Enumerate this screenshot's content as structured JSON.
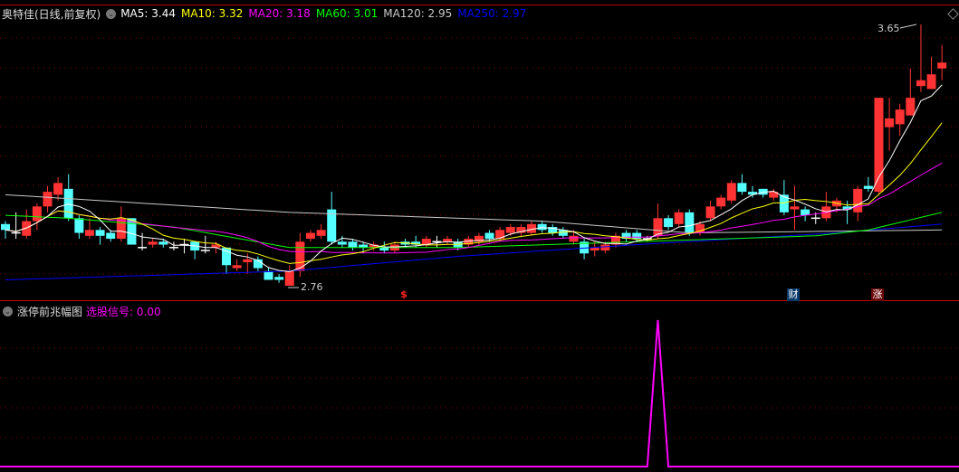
{
  "header": {
    "stock_name": "奥特佳(日线,前复权)",
    "ma_labels": [
      {
        "text": "MA5: 3.44",
        "color": "#ffffff"
      },
      {
        "text": "MA10: 3.32",
        "color": "#ffff00"
      },
      {
        "text": "MA20: 3.18",
        "color": "#ff00ff"
      },
      {
        "text": "MA60: 3.01",
        "color": "#00ff00"
      },
      {
        "text": "MA120: 2.95",
        "color": "#c8c8c8"
      },
      {
        "text": "MA250: 2.97",
        "color": "#0000ff"
      }
    ]
  },
  "indicator": {
    "name": "涨停前兆幅图",
    "signal_label": "选股信号: 0.00",
    "signal_color": "#ff00ff"
  },
  "annotations": {
    "high_label": "3.65",
    "low_label": "2.76",
    "marker_dollar": "$",
    "marker_cai": "财",
    "marker_zhang": "涨"
  },
  "colors": {
    "up": "#ff3333",
    "down": "#55ffff",
    "doji": "#ffffff",
    "grid": "#880000",
    "separator": "#cc0000"
  },
  "chart_data": {
    "type": "candlestick",
    "ylim": [
      2.76,
      3.65
    ],
    "candles": [
      [
        2.97,
        2.95,
        2.98,
        2.92
      ],
      [
        2.94,
        2.94,
        3.01,
        2.92
      ],
      [
        2.93,
        2.98,
        3.02,
        2.92
      ],
      [
        2.98,
        3.03,
        3.04,
        2.95
      ],
      [
        3.03,
        3.08,
        3.1,
        3.01
      ],
      [
        3.07,
        3.11,
        3.13,
        3.05
      ],
      [
        3.09,
        2.99,
        3.14,
        2.98
      ],
      [
        2.99,
        2.94,
        3.0,
        2.92
      ],
      [
        2.93,
        2.95,
        2.99,
        2.92
      ],
      [
        2.95,
        2.93,
        2.96,
        2.9
      ],
      [
        2.94,
        2.92,
        2.95,
        2.91
      ],
      [
        2.92,
        2.99,
        3.03,
        2.91
      ],
      [
        2.99,
        2.9,
        2.99,
        2.9
      ],
      [
        2.89,
        2.89,
        2.94,
        2.88
      ],
      [
        2.9,
        2.91,
        2.92,
        2.89
      ],
      [
        2.91,
        2.9,
        2.92,
        2.89
      ],
      [
        2.89,
        2.89,
        2.91,
        2.88
      ],
      [
        2.9,
        2.9,
        2.92,
        2.87
      ],
      [
        2.91,
        2.88,
        2.91,
        2.85
      ],
      [
        2.88,
        2.88,
        2.93,
        2.87
      ],
      [
        2.89,
        2.9,
        2.91,
        2.87
      ],
      [
        2.89,
        2.83,
        2.89,
        2.8
      ],
      [
        2.82,
        2.83,
        2.85,
        2.81
      ],
      [
        2.84,
        2.85,
        2.87,
        2.8
      ],
      [
        2.85,
        2.82,
        2.86,
        2.81
      ],
      [
        2.81,
        2.78,
        2.82,
        2.78
      ],
      [
        2.79,
        2.78,
        2.8,
        2.77
      ],
      [
        2.76,
        2.81,
        2.83,
        2.76
      ],
      [
        2.81,
        2.91,
        2.94,
        2.79
      ],
      [
        2.92,
        2.94,
        2.95,
        2.91
      ],
      [
        2.93,
        2.95,
        2.97,
        2.92
      ],
      [
        3.02,
        2.91,
        3.08,
        2.9
      ],
      [
        2.91,
        2.9,
        2.93,
        2.89
      ],
      [
        2.91,
        2.89,
        2.92,
        2.88
      ],
      [
        2.9,
        2.89,
        2.91,
        2.87
      ],
      [
        2.89,
        2.9,
        2.91,
        2.88
      ],
      [
        2.89,
        2.88,
        2.91,
        2.87
      ],
      [
        2.88,
        2.9,
        2.91,
        2.87
      ],
      [
        2.91,
        2.9,
        2.92,
        2.89
      ],
      [
        2.91,
        2.9,
        2.93,
        2.89
      ],
      [
        2.9,
        2.92,
        2.93,
        2.89
      ],
      [
        2.91,
        2.91,
        2.93,
        2.89
      ],
      [
        2.91,
        2.92,
        2.93,
        2.9
      ],
      [
        2.91,
        2.89,
        2.92,
        2.88
      ],
      [
        2.9,
        2.92,
        2.93,
        2.89
      ],
      [
        2.91,
        2.93,
        2.94,
        2.9
      ],
      [
        2.94,
        2.92,
        2.95,
        2.91
      ],
      [
        2.92,
        2.95,
        2.96,
        2.91
      ],
      [
        2.94,
        2.96,
        2.97,
        2.93
      ],
      [
        2.94,
        2.96,
        2.97,
        2.93
      ],
      [
        2.94,
        2.97,
        2.98,
        2.93
      ],
      [
        2.97,
        2.95,
        2.98,
        2.94
      ],
      [
        2.96,
        2.94,
        2.97,
        2.93
      ],
      [
        2.95,
        2.93,
        2.96,
        2.92
      ],
      [
        2.91,
        2.93,
        2.95,
        2.9
      ],
      [
        2.91,
        2.87,
        2.92,
        2.85
      ],
      [
        2.88,
        2.89,
        2.91,
        2.86
      ],
      [
        2.88,
        2.9,
        2.91,
        2.87
      ],
      [
        2.9,
        2.93,
        2.94,
        2.89
      ],
      [
        2.94,
        2.92,
        2.95,
        2.91
      ],
      [
        2.94,
        2.92,
        2.95,
        2.91
      ],
      [
        2.92,
        2.92,
        2.93,
        2.91
      ],
      [
        2.93,
        2.99,
        3.04,
        2.92
      ],
      [
        2.99,
        2.96,
        3.0,
        2.95
      ],
      [
        2.97,
        3.01,
        3.02,
        2.96
      ],
      [
        3.01,
        2.94,
        3.02,
        2.93
      ],
      [
        2.94,
        2.97,
        2.98,
        2.93
      ],
      [
        2.99,
        3.03,
        3.05,
        2.98
      ],
      [
        3.03,
        3.06,
        3.07,
        3.02
      ],
      [
        3.05,
        3.11,
        3.12,
        3.04
      ],
      [
        3.11,
        3.08,
        3.14,
        3.07
      ],
      [
        3.08,
        3.07,
        3.1,
        3.06
      ],
      [
        3.09,
        3.07,
        3.09,
        3.06
      ],
      [
        3.06,
        3.08,
        3.09,
        3.05
      ],
      [
        3.07,
        3.01,
        3.12,
        3.0
      ],
      [
        3.02,
        3.03,
        3.1,
        2.95
      ],
      [
        3.02,
        3.0,
        3.03,
        2.98
      ],
      [
        2.99,
        2.99,
        3.01,
        2.97
      ],
      [
        2.99,
        3.03,
        3.08,
        2.98
      ],
      [
        3.03,
        3.05,
        3.06,
        3.01
      ],
      [
        3.03,
        3.02,
        3.05,
        2.97
      ],
      [
        3.01,
        3.09,
        3.1,
        2.98
      ],
      [
        3.1,
        3.09,
        3.13,
        3.08
      ],
      [
        3.08,
        3.4,
        3.4,
        3.07
      ],
      [
        3.3,
        3.33,
        3.4,
        3.22
      ],
      [
        3.31,
        3.36,
        3.38,
        3.27
      ],
      [
        3.34,
        3.4,
        3.5,
        3.34
      ],
      [
        3.44,
        3.46,
        3.65,
        3.42
      ],
      [
        3.43,
        3.48,
        3.54,
        3.43
      ],
      [
        3.5,
        3.52,
        3.58,
        3.46
      ]
    ],
    "candle_fields": [
      "open",
      "close",
      "high",
      "low"
    ],
    "ma_long": {
      "MA60": {
        "at_index": [
          0,
          6,
          16,
          27,
          43,
          60,
          77,
          82,
          89
        ],
        "values": [
          3.0,
          2.99,
          2.96,
          2.89,
          2.89,
          2.91,
          2.93,
          2.95,
          3.01
        ],
        "color": "#00ff00"
      },
      "MA120": {
        "at_index": [
          0,
          27,
          51,
          65,
          89
        ],
        "values": [
          3.07,
          3.01,
          2.98,
          2.94,
          2.95
        ],
        "color": "#c8c8c8"
      },
      "MA250": {
        "at_index": [
          0,
          27,
          43,
          60,
          79,
          89
        ],
        "values": [
          2.78,
          2.81,
          2.86,
          2.9,
          2.94,
          2.97
        ],
        "color": "#0000ff"
      }
    },
    "signal": {
      "spike_index": 62,
      "spike_value": 1,
      "baseline": 0,
      "ylim": [
        0,
        1
      ]
    }
  }
}
